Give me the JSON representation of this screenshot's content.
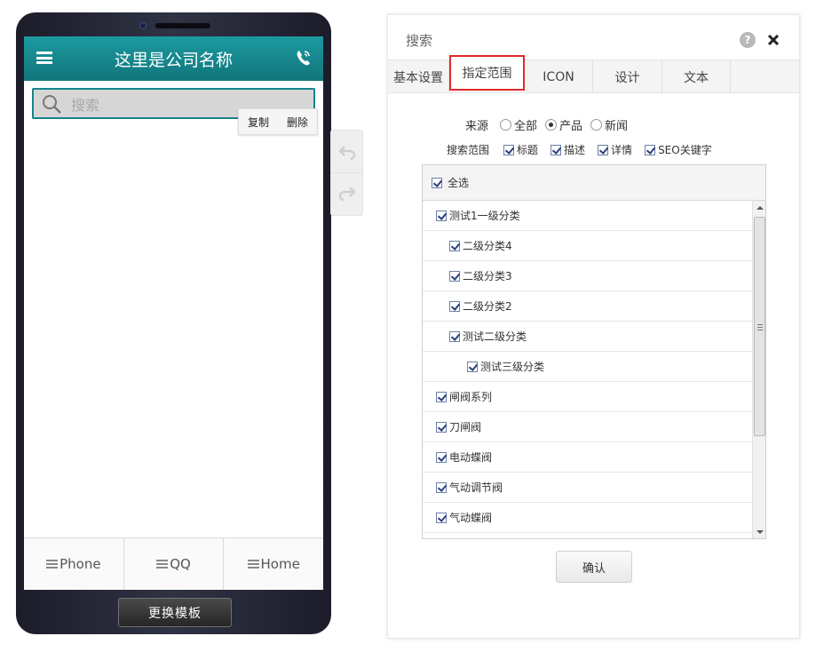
{
  "phone": {
    "company_name": "这里是公司名称",
    "search_placeholder": "搜索",
    "context_menu": {
      "copy": "复制",
      "delete": "删除"
    },
    "bottom_nav": [
      "Phone",
      "QQ",
      "Home"
    ],
    "change_template": "更换模板"
  },
  "dialog": {
    "title": "搜索",
    "help": "?",
    "tabs": [
      "基本设置",
      "指定范围",
      "ICON",
      "设计",
      "文本"
    ],
    "active_tab": "指定范围",
    "source": {
      "label": "来源",
      "options": [
        "全部",
        "产品",
        "新闻"
      ],
      "selected": "产品"
    },
    "scope": {
      "label": "搜索范围",
      "items": [
        "标题",
        "描述",
        "详情",
        "SEO关键字"
      ]
    },
    "select_all": "全选",
    "tree_items": [
      {
        "label": "测试1一级分类",
        "level": 1
      },
      {
        "label": "二级分类4",
        "level": 2
      },
      {
        "label": "二级分类3",
        "level": 2
      },
      {
        "label": "二级分类2",
        "level": 2
      },
      {
        "label": "测试二级分类",
        "level": 2
      },
      {
        "label": "测试三级分类",
        "level": 3
      },
      {
        "label": "闸阀系列",
        "level": 1
      },
      {
        "label": "刀闸阀",
        "level": 1
      },
      {
        "label": "电动蝶阀",
        "level": 1
      },
      {
        "label": "气动调节阀",
        "level": 1
      },
      {
        "label": "气动蝶阀",
        "level": 1
      }
    ],
    "confirm": "确认"
  },
  "colors": {
    "header_teal": "#15848b",
    "active_tab_border": "#e22a2a"
  }
}
